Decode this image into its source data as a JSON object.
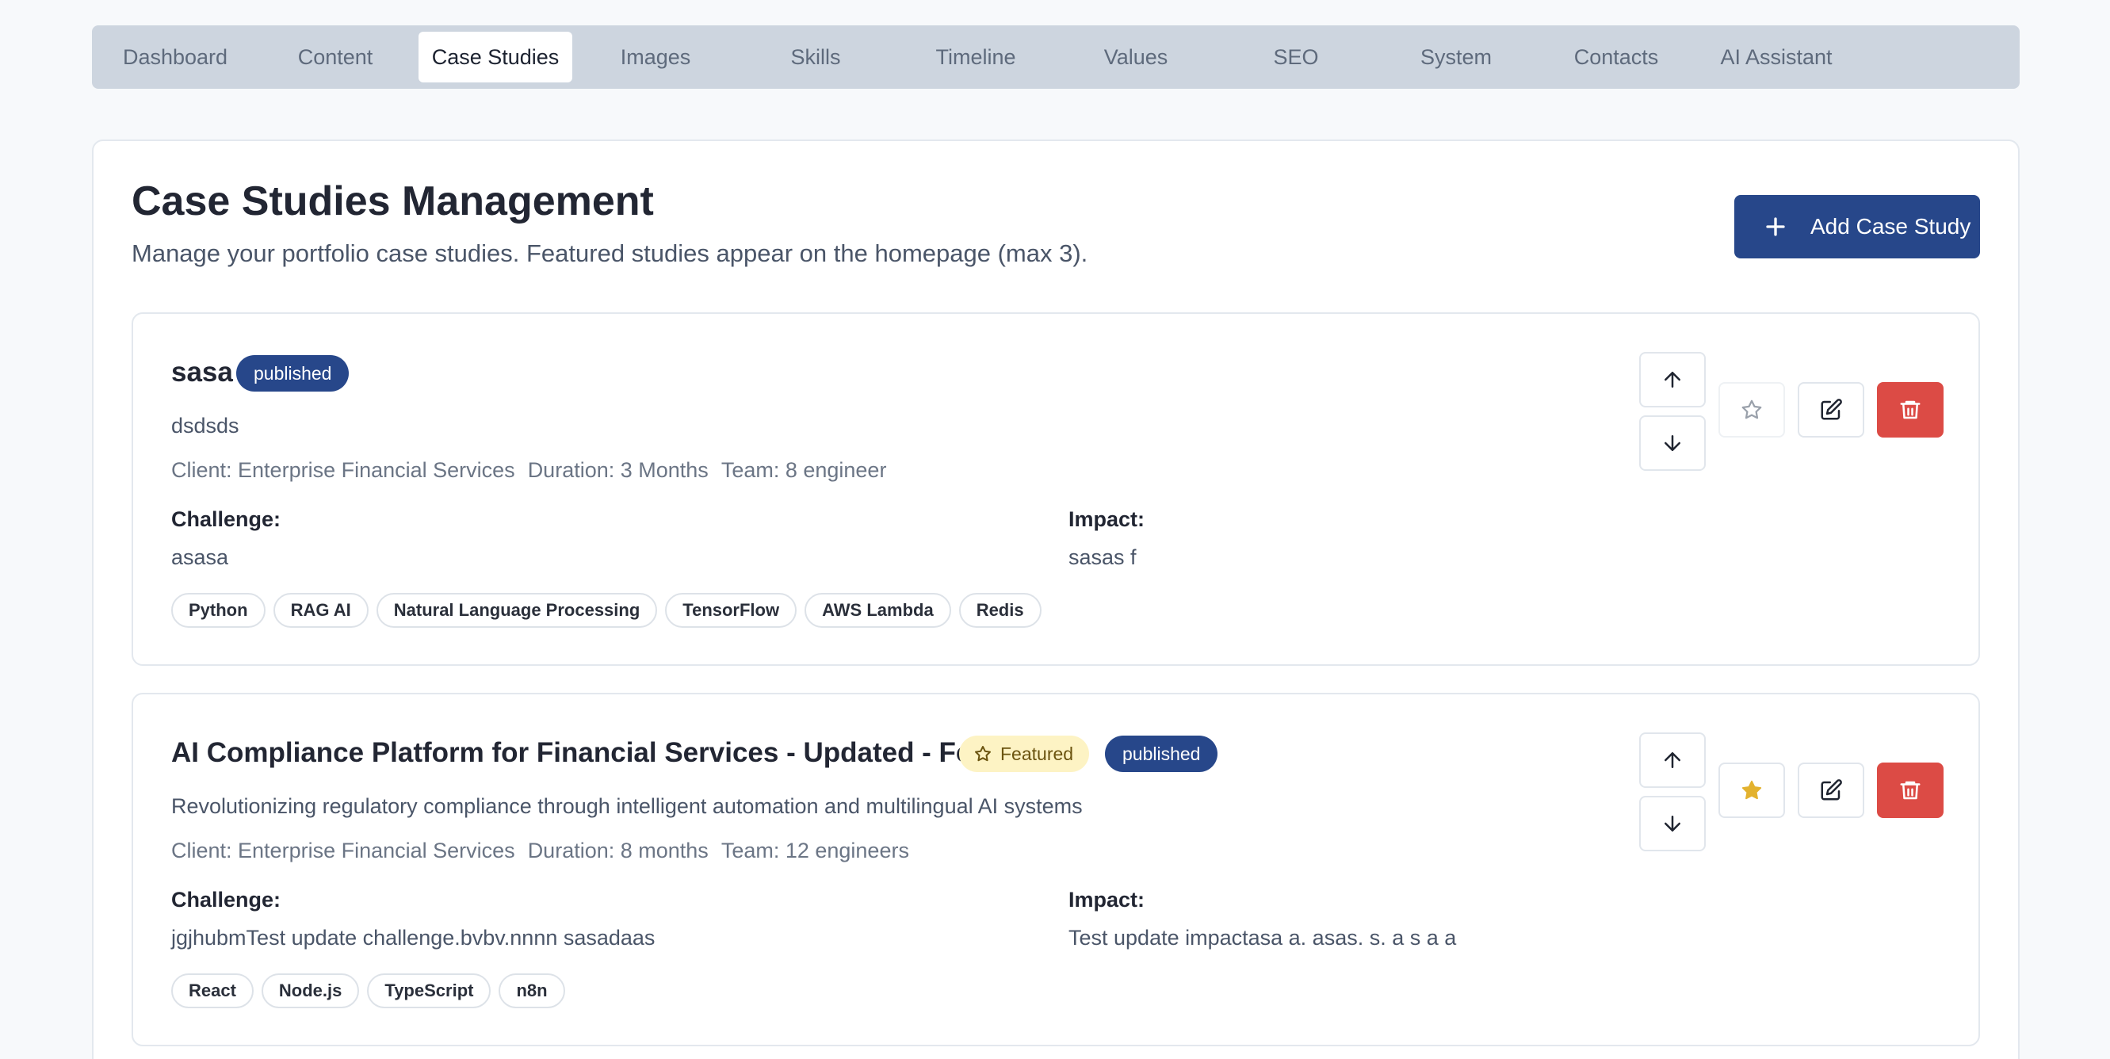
{
  "nav": {
    "tabs": [
      {
        "label": "Dashboard"
      },
      {
        "label": "Content"
      },
      {
        "label": "Case Studies",
        "active": true
      },
      {
        "label": "Images"
      },
      {
        "label": "Skills"
      },
      {
        "label": "Timeline"
      },
      {
        "label": "Values"
      },
      {
        "label": "SEO"
      },
      {
        "label": "System"
      },
      {
        "label": "Contacts"
      },
      {
        "label": "AI Assistant"
      }
    ]
  },
  "header": {
    "title": "Case Studies Management",
    "subtitle": "Manage your portfolio case studies. Featured studies appear on the homepage (max 3).",
    "add_button_label": "Add Case Study"
  },
  "labels": {
    "challenge": "Challenge:",
    "impact": "Impact:",
    "featured": "Featured"
  },
  "colors": {
    "primary": "#27478a",
    "danger": "#dc4b45",
    "featured_bg": "#fdf3c4",
    "star_active": "#e3b22f"
  },
  "case_studies": [
    {
      "title": "sasa",
      "status": "published",
      "featured": false,
      "description": "dsdsds",
      "client": "Client: Enterprise Financial Services",
      "duration": "Duration: 3 Months",
      "team": "Team: 8 engineer",
      "challenge": "asasa",
      "impact": "sasas f",
      "tags": [
        "Python",
        "RAG AI",
        "Natural Language Processing",
        "TensorFlow",
        "AWS Lambda",
        "Redis"
      ]
    },
    {
      "title": "AI Compliance Platform for Financial Services - Updated - Form Test",
      "status": "published",
      "featured": true,
      "description": "Revolutionizing regulatory compliance through intelligent automation and multilingual AI systems",
      "client": "Client: Enterprise Financial Services",
      "duration": "Duration: 8 months",
      "team": "Team: 12 engineers",
      "challenge": "jgjhubmTest update challenge.bvbv.nnnn sasadaas",
      "impact": "Test update impactasa a. asas. s. a s a a",
      "tags": [
        "React",
        "Node.js",
        "TypeScript",
        "n8n"
      ]
    }
  ]
}
